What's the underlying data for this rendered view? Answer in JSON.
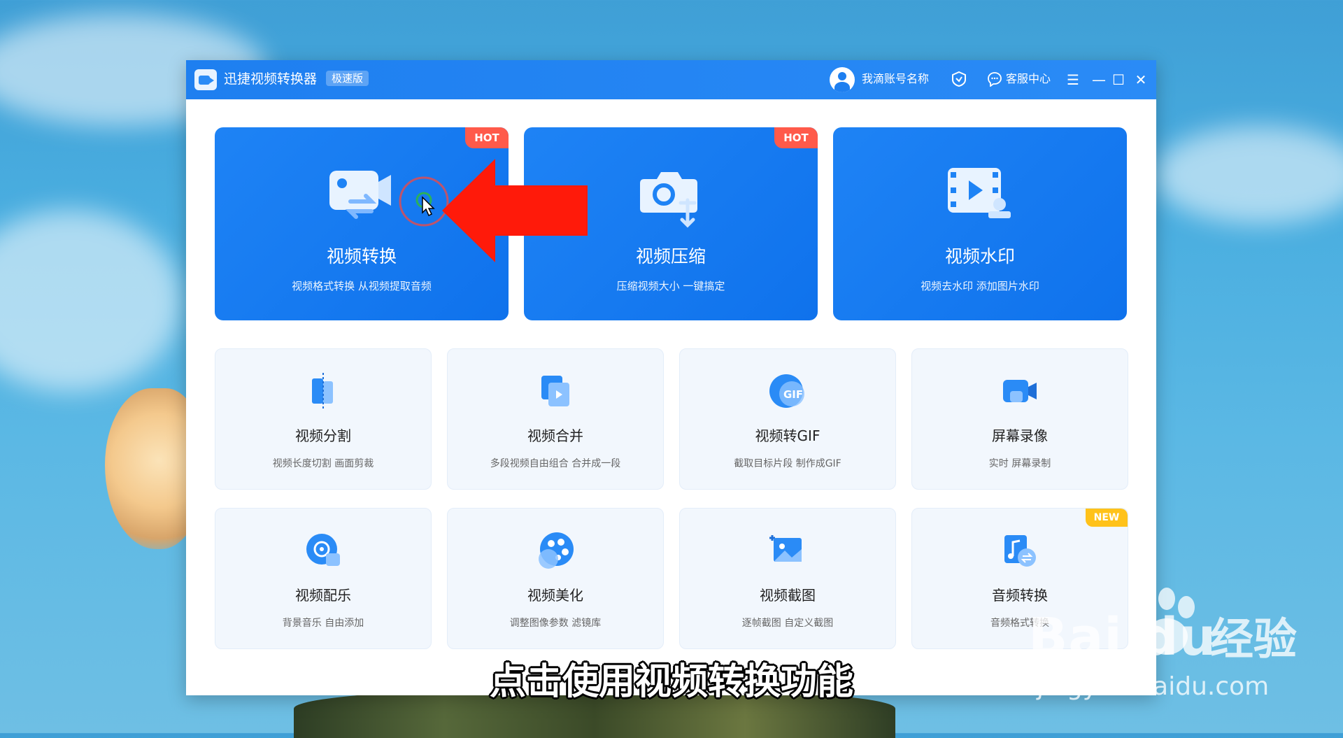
{
  "app": {
    "title": "迅捷视频转换器",
    "edition": "极速版"
  },
  "header": {
    "account_name": "我滴账号名称",
    "support_label": "客服中心"
  },
  "feature_cards": [
    {
      "title": "视频转换",
      "desc": "视频格式转换 从视频提取音频",
      "badge": "HOT"
    },
    {
      "title": "视频压缩",
      "desc": "压缩视频大小 一键搞定",
      "badge": "HOT"
    },
    {
      "title": "视频水印",
      "desc": "视频去水印 添加图片水印"
    }
  ],
  "tools": [
    {
      "title": "视频分割",
      "desc": "视频长度切割 画面剪裁"
    },
    {
      "title": "视频合并",
      "desc": "多段视频自由组合 合并成一段"
    },
    {
      "title": "视频转GIF",
      "desc": "截取目标片段 制作成GIF",
      "icon_text": "GIF"
    },
    {
      "title": "屏幕录像",
      "desc": "实时 屏幕录制"
    },
    {
      "title": "视频配乐",
      "desc": "背景音乐 自由添加"
    },
    {
      "title": "视频美化",
      "desc": "调整图像参数 滤镜库"
    },
    {
      "title": "视频截图",
      "desc": "逐帧截图 自定义截图"
    },
    {
      "title": "音频转换",
      "desc": "音频格式转换",
      "badge": "NEW"
    }
  ],
  "overlay": {
    "subtitle": "点击使用视频转换功能",
    "watermark_logo": "Bai  du",
    "watermark_cn": "经验",
    "watermark_url": "jingyan.baidu.com"
  },
  "colors": {
    "primary": "#1e83f5",
    "hot": "#ff5a4a",
    "new": "#ffc21a",
    "arrow": "#ff1a0a"
  }
}
